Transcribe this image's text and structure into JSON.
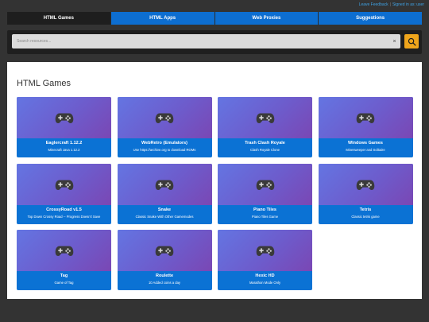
{
  "toplinks": {
    "feedback": "Leave Feedback",
    "separator": "|",
    "signed_in": "Signed in as: user"
  },
  "nav": {
    "tabs": [
      {
        "label": "HTML Games",
        "active": true
      },
      {
        "label": "HTML Apps",
        "active": false
      },
      {
        "label": "Web Proxies",
        "active": false
      },
      {
        "label": "Suggestions",
        "active": false
      }
    ]
  },
  "search": {
    "placeholder": "Search resources...",
    "value": "",
    "clear_icon": "×",
    "search_icon": "search-icon"
  },
  "main": {
    "title": "HTML Games",
    "thumbnail_icon": "gamepad-icon",
    "cards": [
      {
        "name": "Eaglercraft 1.12.2",
        "desc": "Minecraft Java 1.12.2"
      },
      {
        "name": "WebRetro (Emulators)",
        "desc": "Use https://archive.org to download ROMs"
      },
      {
        "name": "Trash Clash Royale",
        "desc": "Clash Royale Clone"
      },
      {
        "name": "Windows Games",
        "desc": "Minesweeper and Solitaire"
      },
      {
        "name": "CrossyRoad v1.5",
        "desc": "Top Down Crossy Road -- Progress Doesn't Save"
      },
      {
        "name": "Snake",
        "desc": "Classic Snake With Other Gamemodes"
      },
      {
        "name": "Piano Tiles",
        "desc": "Piano Tiles Game"
      },
      {
        "name": "Tetris",
        "desc": "Classic tetris game"
      },
      {
        "name": "Tag",
        "desc": "Game of Tag"
      },
      {
        "name": "Roulette",
        "desc": "10 Added coins a day"
      },
      {
        "name": "Hexic HD",
        "desc": "Marathon Mode Only"
      }
    ]
  },
  "colors": {
    "background": "#333333",
    "nav_active": "#1e1e1e",
    "nav_tab": "#0d6ed1",
    "search_button": "#f0a61c",
    "card_footer": "#0b72d4"
  }
}
